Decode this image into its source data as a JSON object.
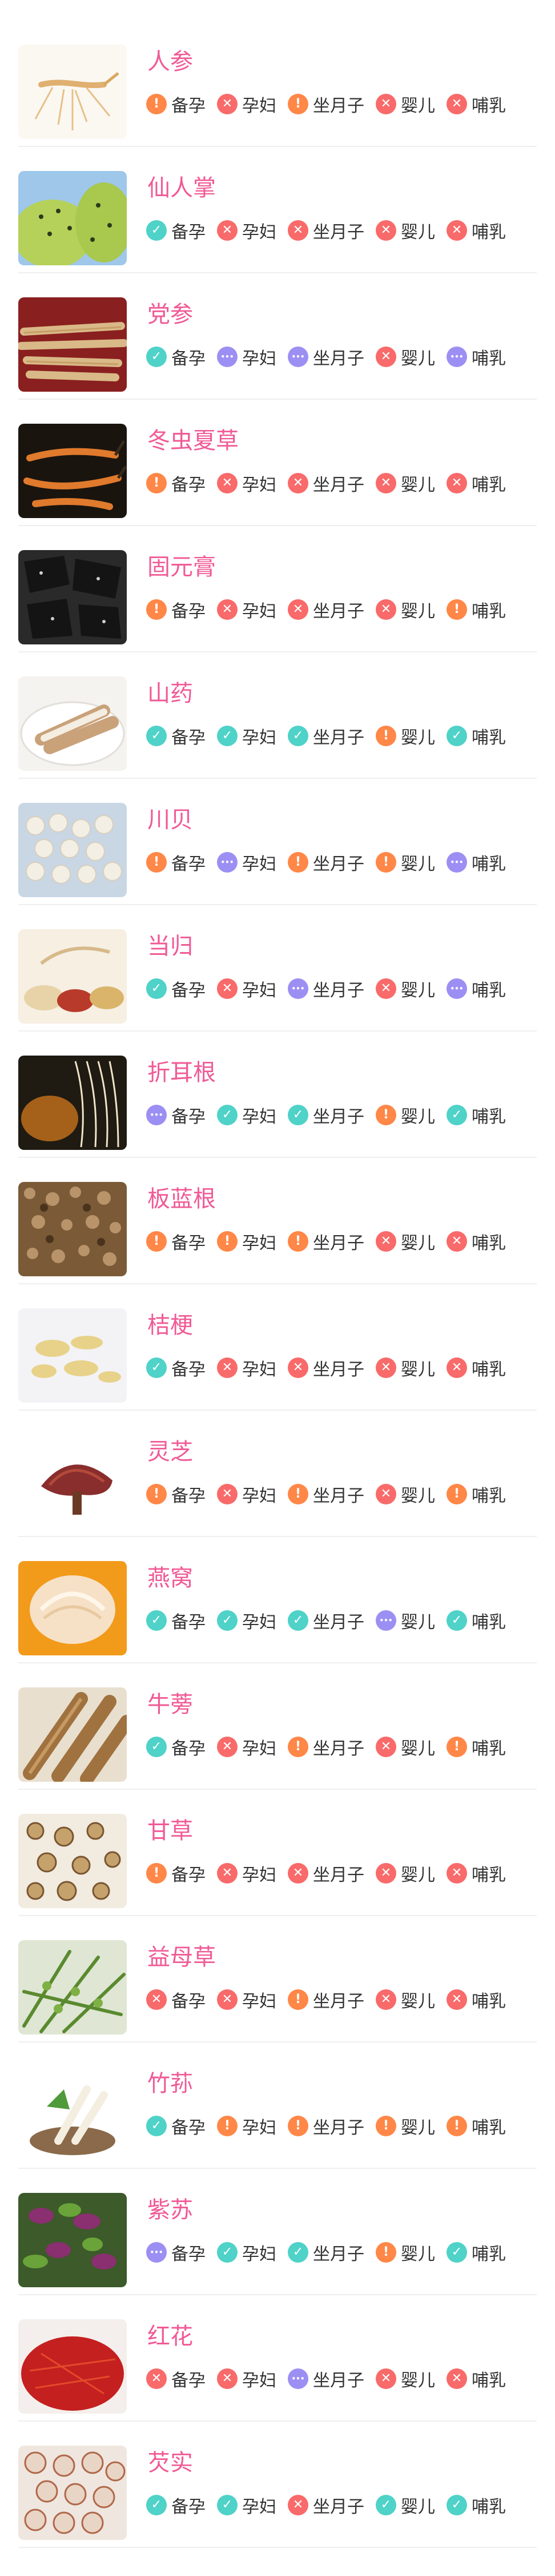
{
  "status_legend": {
    "ok": {
      "icon": "check-icon",
      "color": "#4fd2c8"
    },
    "warn": {
      "icon": "exclamation-icon",
      "color": "#ff8747"
    },
    "no": {
      "icon": "cross-icon",
      "color": "#f96a6a"
    },
    "unk": {
      "icon": "dots-icon",
      "color": "#9c8ff3"
    }
  },
  "tag_labels": [
    "备孕",
    "孕妇",
    "坐月子",
    "婴儿",
    "哺乳"
  ],
  "items": [
    {
      "name": "人参",
      "status": [
        "warn",
        "no",
        "warn",
        "no",
        "no"
      ]
    },
    {
      "name": "仙人掌",
      "status": [
        "ok",
        "no",
        "no",
        "no",
        "no"
      ]
    },
    {
      "name": "党参",
      "status": [
        "ok",
        "unk",
        "unk",
        "no",
        "unk"
      ]
    },
    {
      "name": "冬虫夏草",
      "status": [
        "warn",
        "no",
        "no",
        "no",
        "no"
      ]
    },
    {
      "name": "固元膏",
      "status": [
        "warn",
        "no",
        "no",
        "no",
        "warn"
      ]
    },
    {
      "name": "山药",
      "status": [
        "ok",
        "ok",
        "ok",
        "warn",
        "ok"
      ]
    },
    {
      "name": "川贝",
      "status": [
        "warn",
        "unk",
        "warn",
        "warn",
        "unk"
      ]
    },
    {
      "name": "当归",
      "status": [
        "ok",
        "no",
        "unk",
        "no",
        "unk"
      ]
    },
    {
      "name": "折耳根",
      "status": [
        "unk",
        "ok",
        "ok",
        "warn",
        "ok"
      ]
    },
    {
      "name": "板蓝根",
      "status": [
        "warn",
        "warn",
        "warn",
        "no",
        "no"
      ]
    },
    {
      "name": "桔梗",
      "status": [
        "ok",
        "no",
        "no",
        "no",
        "no"
      ]
    },
    {
      "name": "灵芝",
      "status": [
        "warn",
        "no",
        "warn",
        "no",
        "warn"
      ]
    },
    {
      "name": "燕窝",
      "status": [
        "ok",
        "ok",
        "ok",
        "unk",
        "ok"
      ]
    },
    {
      "name": "牛蒡",
      "status": [
        "ok",
        "no",
        "warn",
        "no",
        "warn"
      ]
    },
    {
      "name": "甘草",
      "status": [
        "warn",
        "no",
        "no",
        "no",
        "no"
      ]
    },
    {
      "name": "益母草",
      "status": [
        "no",
        "no",
        "warn",
        "no",
        "no"
      ]
    },
    {
      "name": "竹荪",
      "status": [
        "ok",
        "warn",
        "warn",
        "warn",
        "warn"
      ]
    },
    {
      "name": "紫苏",
      "status": [
        "unk",
        "ok",
        "ok",
        "warn",
        "ok"
      ]
    },
    {
      "name": "红花",
      "status": [
        "no",
        "no",
        "unk",
        "no",
        "no"
      ]
    },
    {
      "name": "芡实",
      "status": [
        "ok",
        "ok",
        "no",
        "ok",
        "ok"
      ]
    }
  ]
}
